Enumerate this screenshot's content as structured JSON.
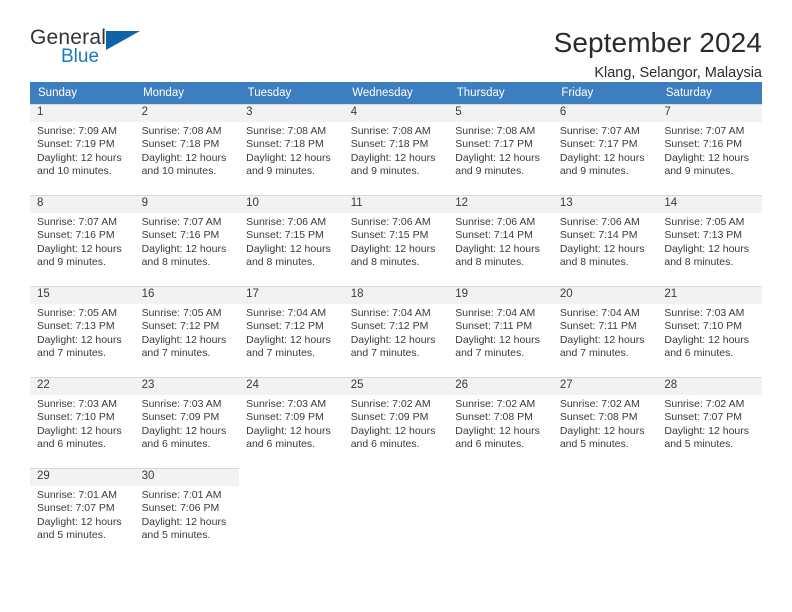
{
  "brand": {
    "name_part1": "General",
    "name_part2": "Blue",
    "logo_icon": "blue-triangle-icon",
    "color_primary": "#1063a5",
    "color_secondary": "#1879bf"
  },
  "header": {
    "title": "September 2024",
    "subtitle": "Klang, Selangor, Malaysia"
  },
  "calendar": {
    "header_bg": "#3c7ebf",
    "daynum_bg": "#f2f2f2",
    "weekdays": [
      "Sunday",
      "Monday",
      "Tuesday",
      "Wednesday",
      "Thursday",
      "Friday",
      "Saturday"
    ],
    "labels": {
      "sunrise": "Sunrise:",
      "sunset": "Sunset:",
      "daylight": "Daylight:"
    },
    "weeks": [
      [
        {
          "day": "1",
          "sunrise": "Sunrise: 7:09 AM",
          "sunset": "Sunset: 7:19 PM",
          "daylight_line1": "Daylight: 12 hours",
          "daylight_line2": "and 10 minutes."
        },
        {
          "day": "2",
          "sunrise": "Sunrise: 7:08 AM",
          "sunset": "Sunset: 7:18 PM",
          "daylight_line1": "Daylight: 12 hours",
          "daylight_line2": "and 10 minutes."
        },
        {
          "day": "3",
          "sunrise": "Sunrise: 7:08 AM",
          "sunset": "Sunset: 7:18 PM",
          "daylight_line1": "Daylight: 12 hours",
          "daylight_line2": "and 9 minutes."
        },
        {
          "day": "4",
          "sunrise": "Sunrise: 7:08 AM",
          "sunset": "Sunset: 7:18 PM",
          "daylight_line1": "Daylight: 12 hours",
          "daylight_line2": "and 9 minutes."
        },
        {
          "day": "5",
          "sunrise": "Sunrise: 7:08 AM",
          "sunset": "Sunset: 7:17 PM",
          "daylight_line1": "Daylight: 12 hours",
          "daylight_line2": "and 9 minutes."
        },
        {
          "day": "6",
          "sunrise": "Sunrise: 7:07 AM",
          "sunset": "Sunset: 7:17 PM",
          "daylight_line1": "Daylight: 12 hours",
          "daylight_line2": "and 9 minutes."
        },
        {
          "day": "7",
          "sunrise": "Sunrise: 7:07 AM",
          "sunset": "Sunset: 7:16 PM",
          "daylight_line1": "Daylight: 12 hours",
          "daylight_line2": "and 9 minutes."
        }
      ],
      [
        {
          "day": "8",
          "sunrise": "Sunrise: 7:07 AM",
          "sunset": "Sunset: 7:16 PM",
          "daylight_line1": "Daylight: 12 hours",
          "daylight_line2": "and 9 minutes."
        },
        {
          "day": "9",
          "sunrise": "Sunrise: 7:07 AM",
          "sunset": "Sunset: 7:16 PM",
          "daylight_line1": "Daylight: 12 hours",
          "daylight_line2": "and 8 minutes."
        },
        {
          "day": "10",
          "sunrise": "Sunrise: 7:06 AM",
          "sunset": "Sunset: 7:15 PM",
          "daylight_line1": "Daylight: 12 hours",
          "daylight_line2": "and 8 minutes."
        },
        {
          "day": "11",
          "sunrise": "Sunrise: 7:06 AM",
          "sunset": "Sunset: 7:15 PM",
          "daylight_line1": "Daylight: 12 hours",
          "daylight_line2": "and 8 minutes."
        },
        {
          "day": "12",
          "sunrise": "Sunrise: 7:06 AM",
          "sunset": "Sunset: 7:14 PM",
          "daylight_line1": "Daylight: 12 hours",
          "daylight_line2": "and 8 minutes."
        },
        {
          "day": "13",
          "sunrise": "Sunrise: 7:06 AM",
          "sunset": "Sunset: 7:14 PM",
          "daylight_line1": "Daylight: 12 hours",
          "daylight_line2": "and 8 minutes."
        },
        {
          "day": "14",
          "sunrise": "Sunrise: 7:05 AM",
          "sunset": "Sunset: 7:13 PM",
          "daylight_line1": "Daylight: 12 hours",
          "daylight_line2": "and 8 minutes."
        }
      ],
      [
        {
          "day": "15",
          "sunrise": "Sunrise: 7:05 AM",
          "sunset": "Sunset: 7:13 PM",
          "daylight_line1": "Daylight: 12 hours",
          "daylight_line2": "and 7 minutes."
        },
        {
          "day": "16",
          "sunrise": "Sunrise: 7:05 AM",
          "sunset": "Sunset: 7:12 PM",
          "daylight_line1": "Daylight: 12 hours",
          "daylight_line2": "and 7 minutes."
        },
        {
          "day": "17",
          "sunrise": "Sunrise: 7:04 AM",
          "sunset": "Sunset: 7:12 PM",
          "daylight_line1": "Daylight: 12 hours",
          "daylight_line2": "and 7 minutes."
        },
        {
          "day": "18",
          "sunrise": "Sunrise: 7:04 AM",
          "sunset": "Sunset: 7:12 PM",
          "daylight_line1": "Daylight: 12 hours",
          "daylight_line2": "and 7 minutes."
        },
        {
          "day": "19",
          "sunrise": "Sunrise: 7:04 AM",
          "sunset": "Sunset: 7:11 PM",
          "daylight_line1": "Daylight: 12 hours",
          "daylight_line2": "and 7 minutes."
        },
        {
          "day": "20",
          "sunrise": "Sunrise: 7:04 AM",
          "sunset": "Sunset: 7:11 PM",
          "daylight_line1": "Daylight: 12 hours",
          "daylight_line2": "and 7 minutes."
        },
        {
          "day": "21",
          "sunrise": "Sunrise: 7:03 AM",
          "sunset": "Sunset: 7:10 PM",
          "daylight_line1": "Daylight: 12 hours",
          "daylight_line2": "and 6 minutes."
        }
      ],
      [
        {
          "day": "22",
          "sunrise": "Sunrise: 7:03 AM",
          "sunset": "Sunset: 7:10 PM",
          "daylight_line1": "Daylight: 12 hours",
          "daylight_line2": "and 6 minutes."
        },
        {
          "day": "23",
          "sunrise": "Sunrise: 7:03 AM",
          "sunset": "Sunset: 7:09 PM",
          "daylight_line1": "Daylight: 12 hours",
          "daylight_line2": "and 6 minutes."
        },
        {
          "day": "24",
          "sunrise": "Sunrise: 7:03 AM",
          "sunset": "Sunset: 7:09 PM",
          "daylight_line1": "Daylight: 12 hours",
          "daylight_line2": "and 6 minutes."
        },
        {
          "day": "25",
          "sunrise": "Sunrise: 7:02 AM",
          "sunset": "Sunset: 7:09 PM",
          "daylight_line1": "Daylight: 12 hours",
          "daylight_line2": "and 6 minutes."
        },
        {
          "day": "26",
          "sunrise": "Sunrise: 7:02 AM",
          "sunset": "Sunset: 7:08 PM",
          "daylight_line1": "Daylight: 12 hours",
          "daylight_line2": "and 6 minutes."
        },
        {
          "day": "27",
          "sunrise": "Sunrise: 7:02 AM",
          "sunset": "Sunset: 7:08 PM",
          "daylight_line1": "Daylight: 12 hours",
          "daylight_line2": "and 5 minutes."
        },
        {
          "day": "28",
          "sunrise": "Sunrise: 7:02 AM",
          "sunset": "Sunset: 7:07 PM",
          "daylight_line1": "Daylight: 12 hours",
          "daylight_line2": "and 5 minutes."
        }
      ],
      [
        {
          "day": "29",
          "sunrise": "Sunrise: 7:01 AM",
          "sunset": "Sunset: 7:07 PM",
          "daylight_line1": "Daylight: 12 hours",
          "daylight_line2": "and 5 minutes."
        },
        {
          "day": "30",
          "sunrise": "Sunrise: 7:01 AM",
          "sunset": "Sunset: 7:06 PM",
          "daylight_line1": "Daylight: 12 hours",
          "daylight_line2": "and 5 minutes."
        },
        {
          "day": "",
          "sunrise": "",
          "sunset": "",
          "daylight_line1": "",
          "daylight_line2": ""
        },
        {
          "day": "",
          "sunrise": "",
          "sunset": "",
          "daylight_line1": "",
          "daylight_line2": ""
        },
        {
          "day": "",
          "sunrise": "",
          "sunset": "",
          "daylight_line1": "",
          "daylight_line2": ""
        },
        {
          "day": "",
          "sunrise": "",
          "sunset": "",
          "daylight_line1": "",
          "daylight_line2": ""
        },
        {
          "day": "",
          "sunrise": "",
          "sunset": "",
          "daylight_line1": "",
          "daylight_line2": ""
        }
      ]
    ]
  }
}
